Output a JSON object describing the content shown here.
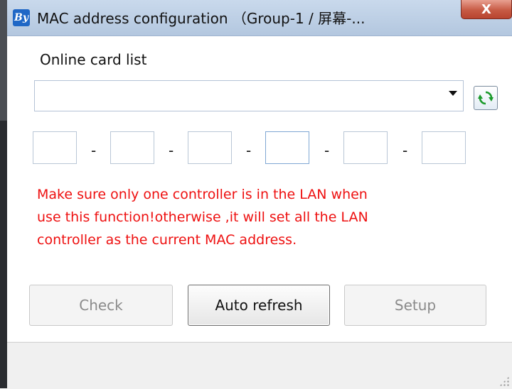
{
  "window": {
    "title": "MAC address configuration （Group-1 / 屏幕-...",
    "icon_label": "By",
    "close_label": "X"
  },
  "online_card": {
    "label": "Online card list",
    "selected": ""
  },
  "mac_fields": [
    "",
    "",
    "",
    "",
    "",
    ""
  ],
  "separator": "-",
  "warning": {
    "line1": "Make sure only one controller is in the LAN when",
    "line2": "use this function!otherwise ,it will set all the LAN",
    "line3": "controller as the current MAC address."
  },
  "buttons": {
    "check": "Check",
    "auto_refresh": "Auto refresh",
    "setup": "Setup"
  },
  "colors": {
    "warning": "#ee1010",
    "refresh_icon": "#1a9a2a"
  }
}
